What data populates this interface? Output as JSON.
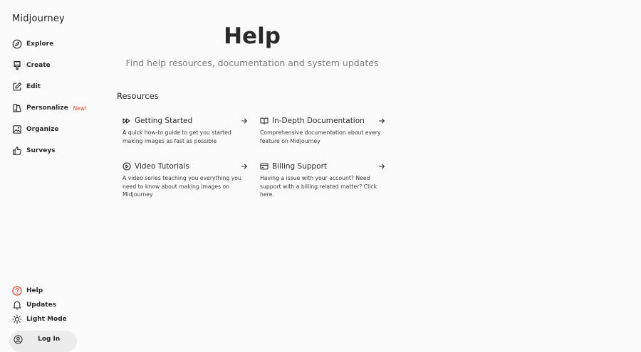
{
  "app": {
    "brand": "Midjourney"
  },
  "sidebar": {
    "items": [
      {
        "label": "Explore",
        "icon": "compass-icon"
      },
      {
        "label": "Create",
        "icon": "brush-icon"
      },
      {
        "label": "Edit",
        "icon": "edit-icon"
      },
      {
        "label": "Personalize",
        "icon": "personalize-icon",
        "badge": "New!"
      },
      {
        "label": "Organize",
        "icon": "image-icon"
      },
      {
        "label": "Surveys",
        "icon": "thumbs-up-icon"
      }
    ],
    "bottom": [
      {
        "label": "Help",
        "icon": "help-circle-icon"
      },
      {
        "label": "Updates",
        "icon": "bell-icon"
      },
      {
        "label": "Light Mode",
        "icon": "sun-icon"
      }
    ],
    "login_label": "Log In"
  },
  "main": {
    "title": "Help",
    "subtitle": "Find help resources, documentation and system updates",
    "section_title": "Resources",
    "cards": [
      {
        "title": "Getting Started",
        "icon": "fast-forward-icon",
        "desc": "A quick how-to guide to get you started making images as fast as possible"
      },
      {
        "title": "In-Depth Documentation",
        "icon": "book-icon",
        "desc": "Comprehensive documentation about every feature on Midjourney"
      },
      {
        "title": "Video Tutorials",
        "icon": "play-circle-icon",
        "desc": "A video series teaching you everything you need to know about making images on Midjourney"
      },
      {
        "title": "Billing Support",
        "icon": "credit-card-icon",
        "desc": "Having a issue with your account? Need support with a billing related matter? Click here."
      }
    ]
  },
  "colors": {
    "accent": "#e0482f",
    "background": "#fbfbfb",
    "text": "#2a2a2a",
    "muted": "#7d7d7d"
  }
}
